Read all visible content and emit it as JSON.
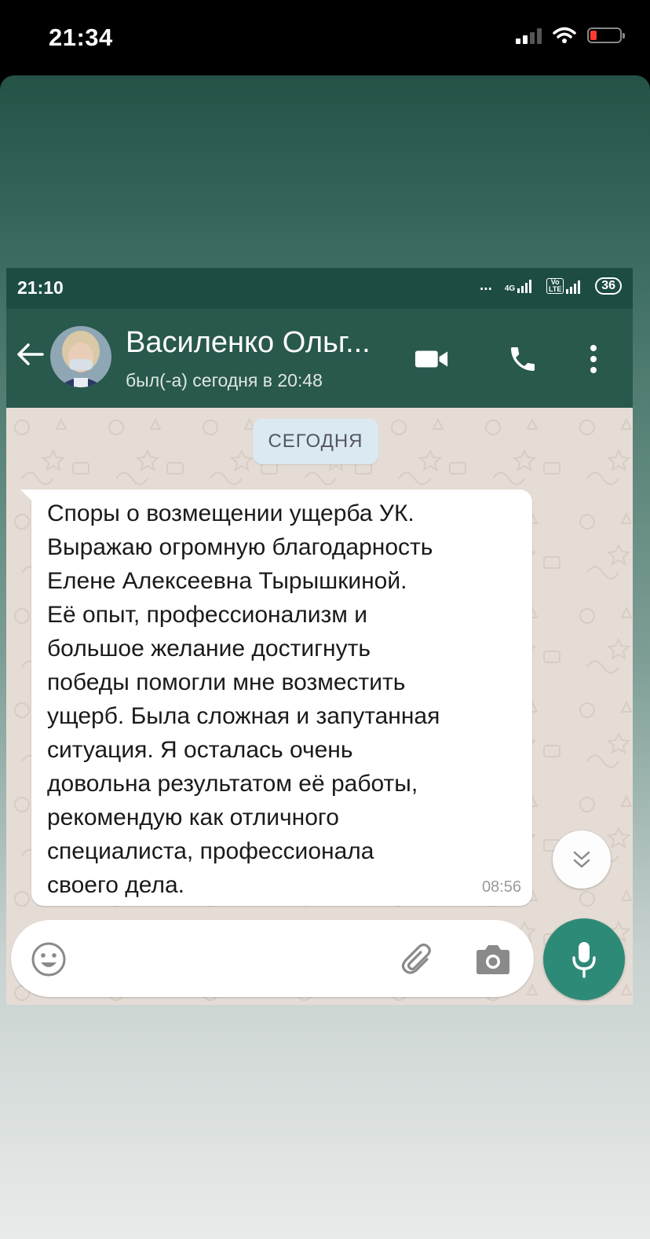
{
  "ios_status": {
    "time": "21:34"
  },
  "android_status": {
    "time": "21:10",
    "dots": "...",
    "network": "4G",
    "volte": "Vo LTE",
    "battery": "36"
  },
  "chat_header": {
    "contact_name": "Василенко Ольг...",
    "last_seen": "был(-а) сегодня в 20:48"
  },
  "date_divider": "СЕГОДНЯ",
  "message": {
    "lines": [
      "Споры о возмещении ущерба УК.",
      "Выражаю огромную благодарность",
      "Елене Алексеевна Тырышкиной.",
      "Её опыт, профессионализм и",
      "большое желание достигнуть",
      "победы помогли мне возместить",
      "ущерб. Была сложная и запутанная",
      "ситуация. Я осталась очень",
      "довольна результатом её работы,",
      "рекомендую как отличного",
      "специалиста, профессионала",
      "своего дела."
    ],
    "time": "08:56"
  },
  "colors": {
    "header": "#29584d",
    "status_bar": "#1d4c43",
    "chat_background": "#e5ddd5",
    "mic_button": "#2d8a77",
    "date_chip": "#dbeaf2"
  },
  "icons": [
    "back-arrow-icon",
    "video-call-icon",
    "phone-icon",
    "more-options-icon",
    "chevron-down-icon",
    "emoji-icon",
    "attach-icon",
    "camera-icon",
    "mic-icon"
  ]
}
